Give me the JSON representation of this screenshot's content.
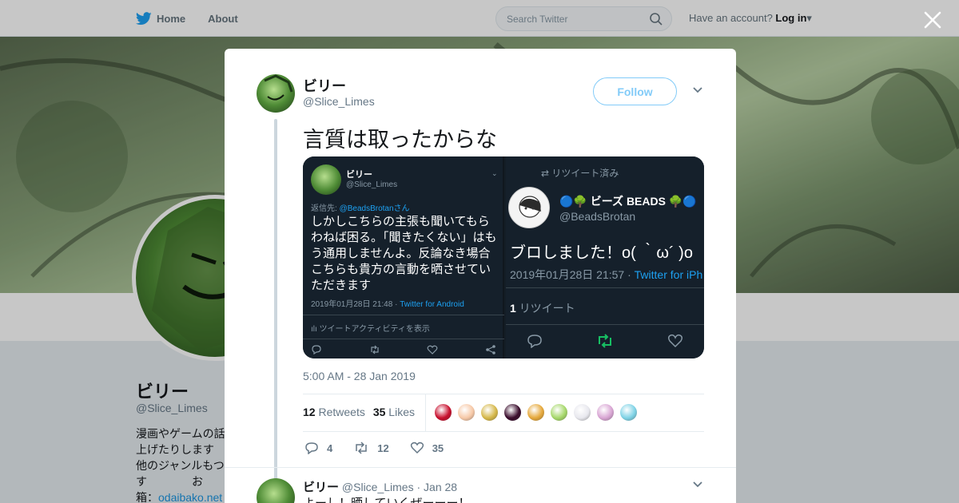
{
  "nav": {
    "home_label": "Home",
    "about_label": "About",
    "search_placeholder": "Search Twitter",
    "account_prompt": "Have an account?",
    "login_label": "Log in"
  },
  "profile": {
    "name": "ビリー",
    "handle": "@Slice_Limes",
    "bio_lines": [
      "漫画やゲームの話",
      "上げたりします",
      "他のジャンルもつ",
      "す　　　　お",
      "箱："
    ],
    "bio_link": "odaibako.net"
  },
  "tweet": {
    "name": "ビリー",
    "handle": "@Slice_Limes",
    "follow_label": "Follow",
    "text": "言質は取ったからな",
    "timestamp": "5:00 AM - 28 Jan 2019",
    "retweets_count": "12",
    "retweets_label": "Retweets",
    "likes_count": "35",
    "likes_label": "Likes",
    "reply_action_count": "4",
    "retweet_action_count": "12",
    "like_action_count": "35"
  },
  "media_left": {
    "name": "ビリー",
    "handle": "@Slice_Limes",
    "reply_prefix": "返信先: ",
    "reply_to": "@BeadsBrotanさん",
    "text": "しかしこちらの主張も聞いてもらわねば困る。「聞きたくない」はもう通用しませんよ。反論なき場合こちらも貴方の言動を晒させていただきます",
    "time": "2019年01月28日 21:48 · ",
    "source": "Twitter for Android",
    "activity": "ılı ツイートアクティビティを表示"
  },
  "media_right": {
    "retweeted_label": "リツイート済み",
    "name": "🔵🌳 ビーズ BEADS 🌳🔵",
    "handle": "@BeadsBrotan",
    "text": "ブロしました！o( ｀ω´ )o",
    "time": "2019年01月28日 21:57 · ",
    "source": "Twitter for iPh",
    "rt_count": "1",
    "rt_label": "リツイート"
  },
  "likers": [
    {
      "color": "#c8102e"
    },
    {
      "color": "#f7c9a8"
    },
    {
      "color": "#d6b84a"
    },
    {
      "color": "#3a0c2c"
    },
    {
      "color": "#e6a93c"
    },
    {
      "color": "#a6d86a"
    },
    {
      "color": "#e8e8ee"
    },
    {
      "color": "#d9a6d4"
    },
    {
      "color": "#7fd3e6"
    }
  ],
  "reply_tweet": {
    "name": "ビリー",
    "handle": "@Slice_Limes",
    "date": "· Jan 28",
    "text": "よーし！晒していくぜーーー！"
  },
  "colors": {
    "accent": "#1da1f2",
    "retweet_green": "#17bf63"
  }
}
